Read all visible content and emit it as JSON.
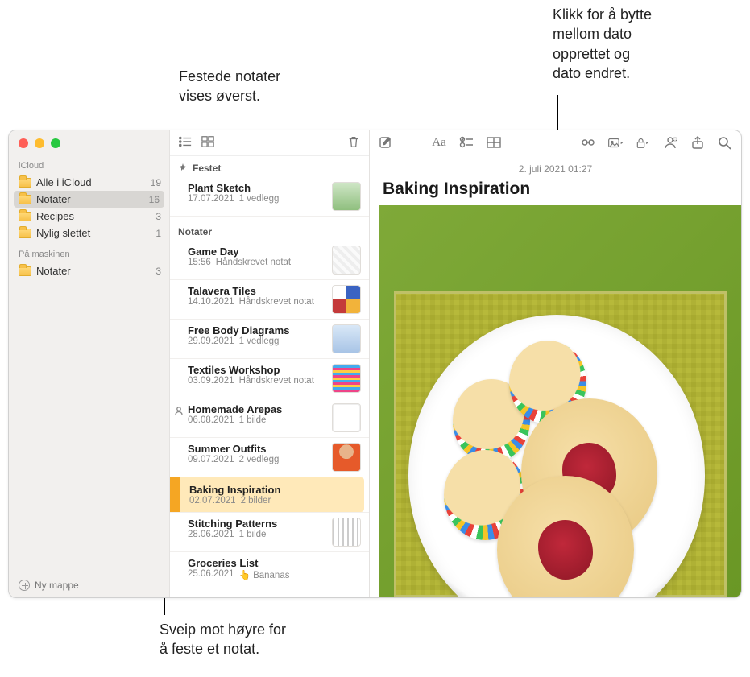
{
  "callouts": {
    "top_left": "Festede notater\nvises øverst.",
    "top_right": "Klikk for å bytte\nmellom dato\nopprettet og\ndato endret.",
    "bottom": "Sveip mot høyre for\nå feste et notat."
  },
  "sidebar": {
    "sections": [
      {
        "header": "iCloud",
        "items": [
          {
            "label": "Alle i iCloud",
            "count": "19",
            "selected": false
          },
          {
            "label": "Notater",
            "count": "16",
            "selected": true
          },
          {
            "label": "Recipes",
            "count": "3",
            "selected": false
          },
          {
            "label": "Nylig slettet",
            "count": "1",
            "selected": false
          }
        ]
      },
      {
        "header": "På maskinen",
        "items": [
          {
            "label": "Notater",
            "count": "3",
            "selected": false
          }
        ]
      }
    ],
    "footer_label": "Ny mappe"
  },
  "notelist": {
    "pinned_header": "Festet",
    "notes_header": "Notater",
    "pinned": [
      {
        "title": "Plant Sketch",
        "date": "17.07.2021",
        "meta": "1 vedlegg",
        "thumb": "plant"
      }
    ],
    "notes": [
      {
        "title": "Game Day",
        "date": "15:56",
        "meta": "Håndskrevet notat",
        "thumb": "game"
      },
      {
        "title": "Talavera Tiles",
        "date": "14.10.2021",
        "meta": "Håndskrevet notat",
        "thumb": "talavera"
      },
      {
        "title": "Free Body Diagrams",
        "date": "29.09.2021",
        "meta": "1 vedlegg",
        "thumb": "fbd"
      },
      {
        "title": "Textiles Workshop",
        "date": "03.09.2021",
        "meta": "Håndskrevet notat",
        "thumb": "textiles"
      },
      {
        "title": "Homemade Arepas",
        "date": "06.08.2021",
        "meta": "1 bilde",
        "thumb": "arepas",
        "shared": true
      },
      {
        "title": "Summer Outfits",
        "date": "09.07.2021",
        "meta": "2 vedlegg",
        "thumb": "summer"
      }
    ],
    "swiped": {
      "title": "Baking Inspiration",
      "date": "02.07.2021",
      "meta": "2 bilder"
    },
    "after_swiped": [
      {
        "title": "Stitching Patterns",
        "date": "28.06.2021",
        "meta": "1 bilde",
        "thumb": "stitch"
      },
      {
        "title": "Groceries List",
        "date": "25.06.2021",
        "meta": "👆 Bananas",
        "thumb": ""
      }
    ]
  },
  "content": {
    "date": "2. juli 2021 01:27",
    "title": "Baking Inspiration"
  },
  "colors": {
    "accent": "#e8950b",
    "swipe_action": "#f5a623",
    "swipe_highlight": "#ffe9b9"
  }
}
